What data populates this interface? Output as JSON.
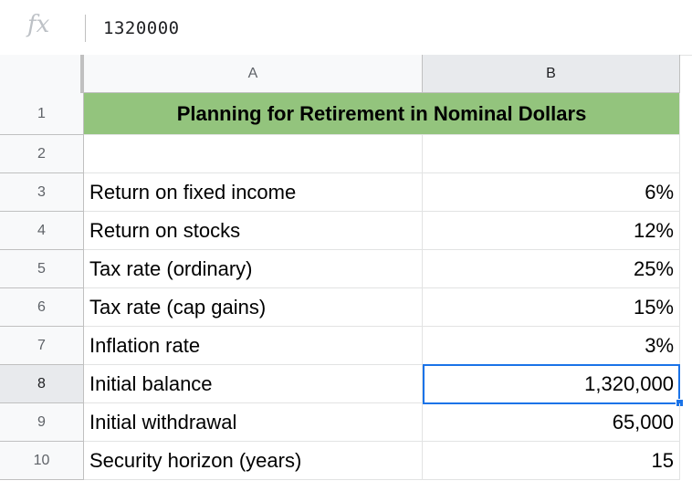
{
  "formula_bar": {
    "fx_label": "fx",
    "value": "1320000"
  },
  "columns": [
    {
      "label": "A",
      "selected": false
    },
    {
      "label": "B",
      "selected": true
    }
  ],
  "title": "Planning for Retirement in Nominal Dollars",
  "rows": [
    {
      "row": "1"
    },
    {
      "row": "2",
      "label": "",
      "value": ""
    },
    {
      "row": "3",
      "label": "Return on fixed income",
      "value": "6%"
    },
    {
      "row": "4",
      "label": "Return on stocks",
      "value": "12%"
    },
    {
      "row": "5",
      "label": "Tax rate (ordinary)",
      "value": "25%"
    },
    {
      "row": "6",
      "label": "Tax rate (cap gains)",
      "value": "15%"
    },
    {
      "row": "7",
      "label": "Inflation rate",
      "value": "3%"
    },
    {
      "row": "8",
      "label": "Initial balance",
      "value": "1,320,000"
    },
    {
      "row": "9",
      "label": "Initial withdrawal",
      "value": "65,000"
    },
    {
      "row": "10",
      "label": "Security horizon (years)",
      "value": "15"
    }
  ],
  "selection": {
    "cell": "B8"
  },
  "colors": {
    "title_fill": "#93c47d",
    "selection": "#1a73e8"
  }
}
